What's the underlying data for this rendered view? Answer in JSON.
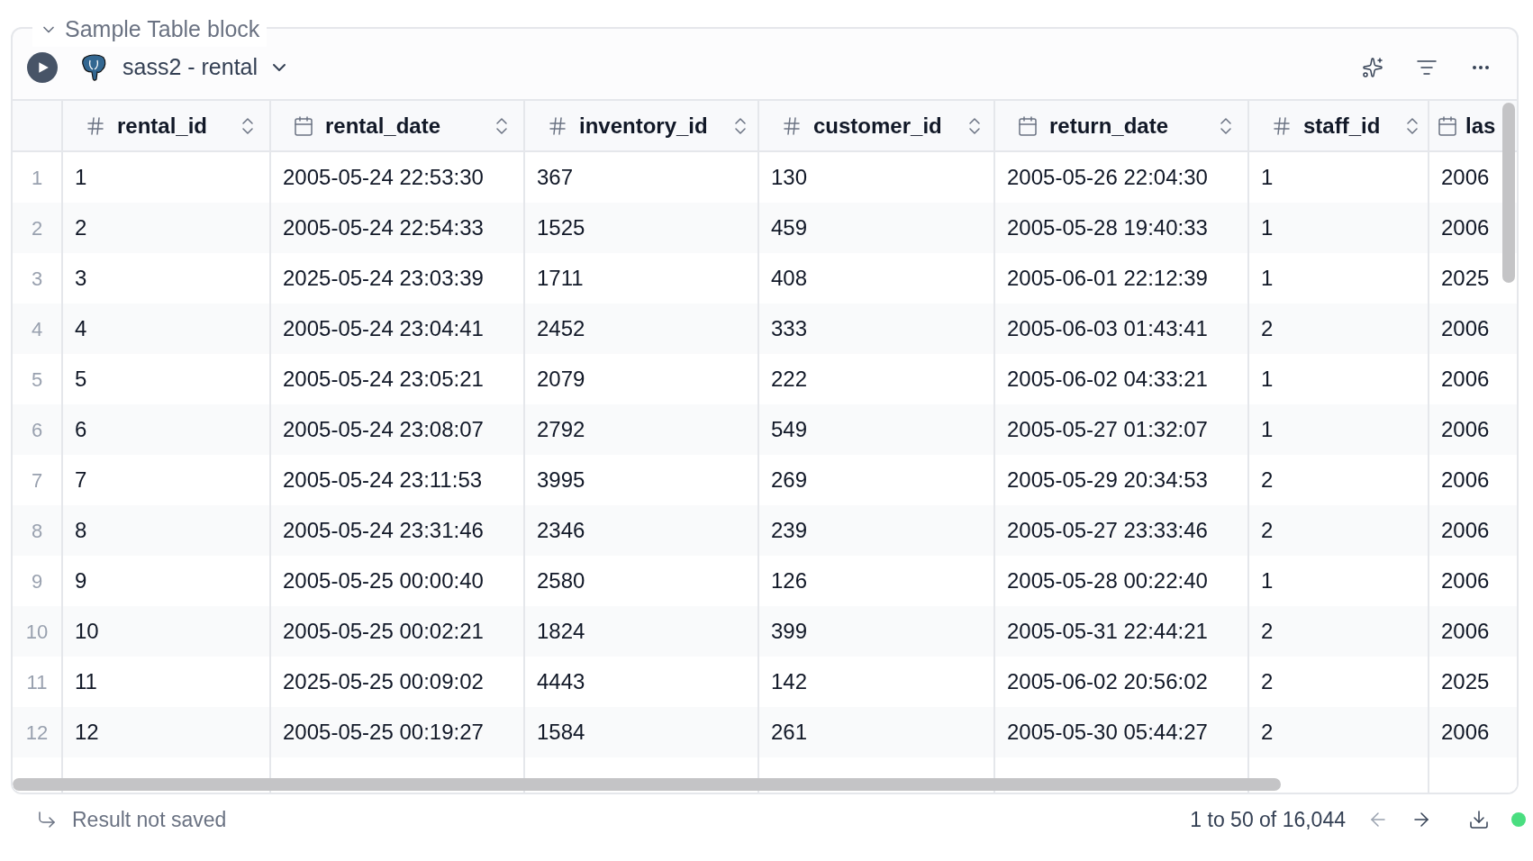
{
  "block": {
    "title": "Sample Table block",
    "expanded": true
  },
  "toolbar": {
    "source": "sass2 - rental"
  },
  "table": {
    "columns": [
      {
        "name": "rental_id",
        "kind": "number"
      },
      {
        "name": "rental_date",
        "kind": "date"
      },
      {
        "name": "inventory_id",
        "kind": "number"
      },
      {
        "name": "customer_id",
        "kind": "number"
      },
      {
        "name": "return_date",
        "kind": "date"
      },
      {
        "name": "staff_id",
        "kind": "number"
      },
      {
        "name": "las",
        "kind": "date"
      }
    ],
    "rows": [
      {
        "index": "1",
        "cells": [
          "1",
          "2005-05-24 22:53:30",
          "367",
          "130",
          "2005-05-26 22:04:30",
          "1",
          "2006"
        ]
      },
      {
        "index": "2",
        "cells": [
          "2",
          "2005-05-24 22:54:33",
          "1525",
          "459",
          "2005-05-28 19:40:33",
          "1",
          "2006"
        ]
      },
      {
        "index": "3",
        "cells": [
          "3",
          "2025-05-24 23:03:39",
          "1711",
          "408",
          "2005-06-01 22:12:39",
          "1",
          "2025"
        ]
      },
      {
        "index": "4",
        "cells": [
          "4",
          "2005-05-24 23:04:41",
          "2452",
          "333",
          "2005-06-03 01:43:41",
          "2",
          "2006"
        ]
      },
      {
        "index": "5",
        "cells": [
          "5",
          "2005-05-24 23:05:21",
          "2079",
          "222",
          "2005-06-02 04:33:21",
          "1",
          "2006"
        ]
      },
      {
        "index": "6",
        "cells": [
          "6",
          "2005-05-24 23:08:07",
          "2792",
          "549",
          "2005-05-27 01:32:07",
          "1",
          "2006"
        ]
      },
      {
        "index": "7",
        "cells": [
          "7",
          "2005-05-24 23:11:53",
          "3995",
          "269",
          "2005-05-29 20:34:53",
          "2",
          "2006"
        ]
      },
      {
        "index": "8",
        "cells": [
          "8",
          "2005-05-24 23:31:46",
          "2346",
          "239",
          "2005-05-27 23:33:46",
          "2",
          "2006"
        ]
      },
      {
        "index": "9",
        "cells": [
          "9",
          "2005-05-25 00:00:40",
          "2580",
          "126",
          "2005-05-28 00:22:40",
          "1",
          "2006"
        ]
      },
      {
        "index": "10",
        "cells": [
          "10",
          "2005-05-25 00:02:21",
          "1824",
          "399",
          "2005-05-31 22:44:21",
          "2",
          "2006"
        ]
      },
      {
        "index": "11",
        "cells": [
          "11",
          "2025-05-25 00:09:02",
          "4443",
          "142",
          "2005-06-02 20:56:02",
          "2",
          "2025"
        ]
      },
      {
        "index": "12",
        "cells": [
          "12",
          "2005-05-25 00:19:27",
          "1584",
          "261",
          "2005-05-30 05:44:27",
          "2",
          "2006"
        ]
      }
    ]
  },
  "footer": {
    "status": "Result not saved",
    "range": "1 to 50 of 16,044",
    "connected": true
  }
}
